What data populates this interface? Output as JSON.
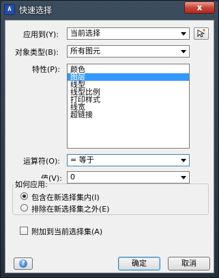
{
  "window": {
    "title": "快速选择",
    "close_label": "x"
  },
  "form": {
    "apply_to": {
      "label": "应用到(Y):",
      "value": "当前选择"
    },
    "object_type": {
      "label": "对象类型(B):",
      "value": "所有图元"
    },
    "properties": {
      "label": "特性(P):",
      "items": [
        "颜色",
        "图层",
        "线型",
        "线型比例",
        "打印样式",
        "线宽",
        "超链接"
      ],
      "selected_index": 1
    },
    "operator": {
      "label": "运算符(O):",
      "value": "= 等于"
    },
    "value": {
      "label": "值(V):",
      "value": "0"
    }
  },
  "how_to_apply": {
    "title": "如何应用:",
    "options": [
      {
        "label": "包含在新选择集内(I)",
        "selected": true
      },
      {
        "label": "排除在新选择集之外(E)",
        "selected": false
      }
    ]
  },
  "append": {
    "label": "附加到当前选择集(A)",
    "checked": false
  },
  "buttons": {
    "ok": "确定",
    "cancel": "取消",
    "help_glyph": "?"
  },
  "icons": {
    "app": "cad-app-icon",
    "pick": "select-objects-icon",
    "help": "help-icon"
  }
}
